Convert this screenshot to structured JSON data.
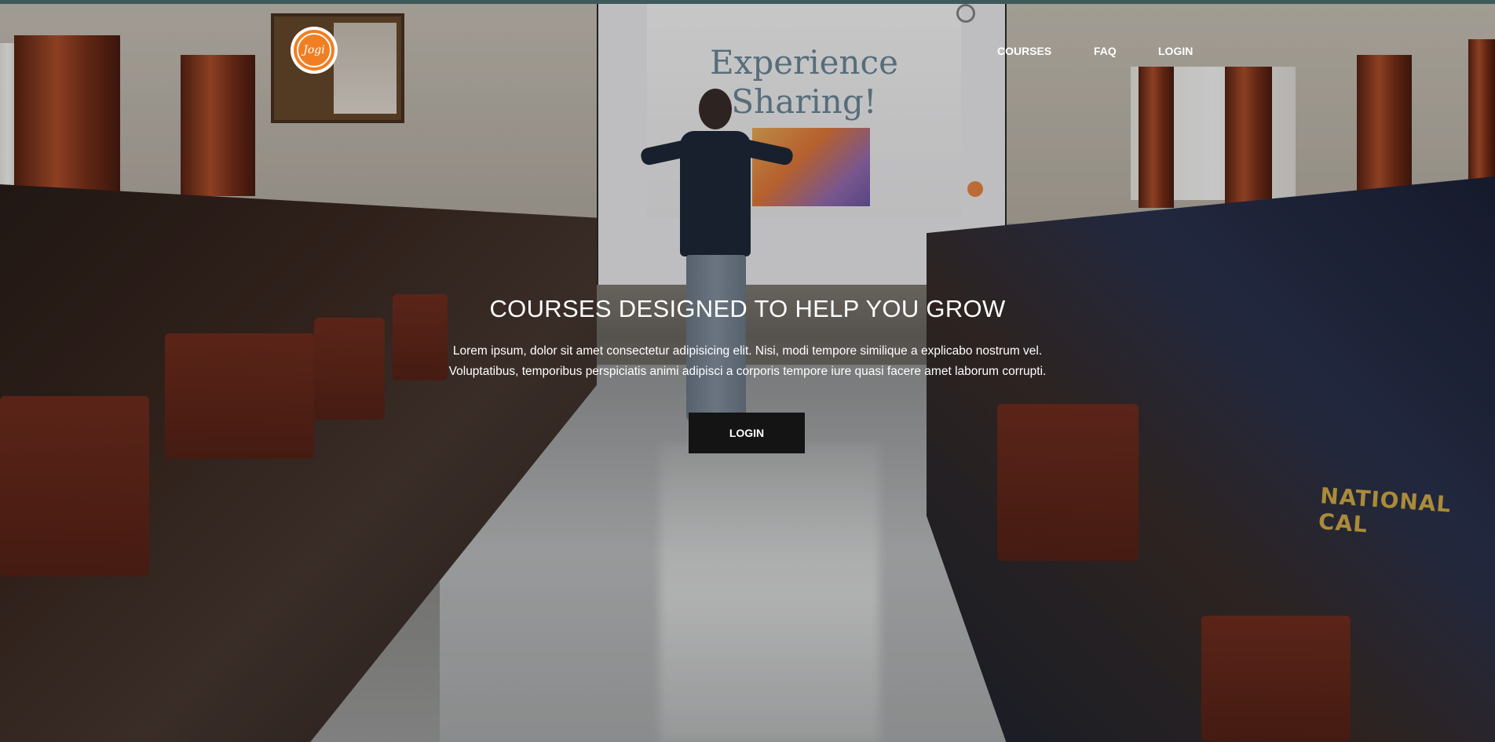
{
  "brand": {
    "logo_text": "Jogi",
    "logo_color": "#f07f24",
    "topbar_color": "#3c5a5a"
  },
  "nav": {
    "items": [
      {
        "label": "COURSES"
      },
      {
        "label": "FAQ"
      },
      {
        "label": "LOGIN"
      }
    ]
  },
  "hero": {
    "title": "COURSES DESIGNED TO HELP YOU GROW",
    "description": "Lorem ipsum, dolor sit amet consectetur adipisicing elit. Nisi, modi tempore similique a explicabo nostrum vel. Voluptatibus, temporibus perspiciatis animi adipisci a corporis tempore iure quasi facere amet laborum corrupti.",
    "button_label": "LOGIN",
    "button_color": "#141414"
  },
  "background": {
    "slide_line1": "Experience",
    "slide_line2": "Sharing!",
    "jacket_text": "NATIONAL CAL"
  }
}
